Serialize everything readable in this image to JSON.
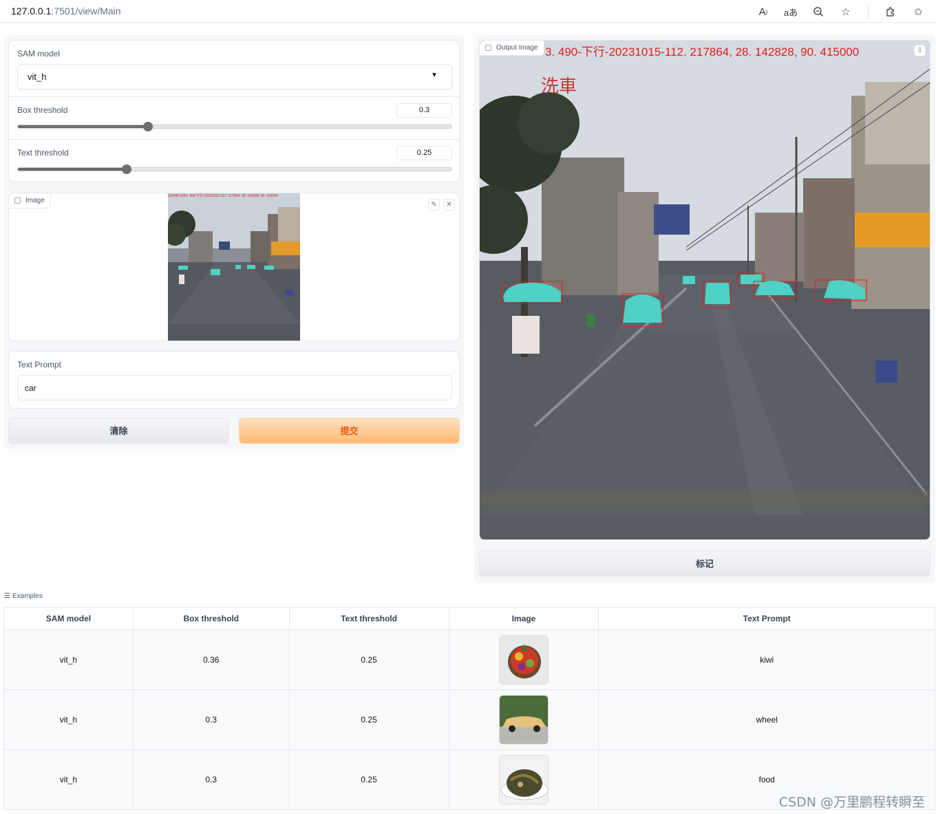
{
  "browser": {
    "url_host": "127.0.0.1",
    "url_path": ":7501/view/Main",
    "icons": [
      "read-aloud-icon",
      "translate-icon",
      "zoom-icon",
      "favorite-star-icon",
      "extensions-icon",
      "favorites-icon"
    ]
  },
  "controls": {
    "sam_model": {
      "label": "SAM model",
      "value": "vit_h"
    },
    "box_threshold": {
      "label": "Box threshold",
      "value": "0.3",
      "fraction": 0.3
    },
    "text_threshold": {
      "label": "Text threshold",
      "value": "0.25",
      "fraction": 0.25
    },
    "image": {
      "label": "Image",
      "caption": "Q234B-2193. 490-下行-20231015-112. 217864, 28. 142828, 90. 415000"
    },
    "text_prompt": {
      "label": "Text Prompt",
      "value": "car"
    }
  },
  "buttons": {
    "clear": "清除",
    "submit": "提交",
    "mark": "标记"
  },
  "output": {
    "label": "Output Image",
    "caption": "3. 490-下行-20231015-112. 217864, 28. 142828, 90. 415000",
    "roadside_sign": "洗車"
  },
  "examples": {
    "title": "Examples",
    "columns": [
      "SAM model",
      "Box threshold",
      "Text threshold",
      "Image",
      "Text Prompt"
    ],
    "rows": [
      {
        "model": "vit_h",
        "box": "0.36",
        "text": "0.25",
        "image": "fruit-plate",
        "prompt": "kiwi"
      },
      {
        "model": "vit_h",
        "box": "0.3",
        "text": "0.25",
        "image": "vintage-car",
        "prompt": "wheel"
      },
      {
        "model": "vit_h",
        "box": "0.3",
        "text": "0.25",
        "image": "food-plate",
        "prompt": "food"
      }
    ]
  },
  "watermark": "CSDN @万里鹏程转瞬至",
  "colors": {
    "accent": "#ea580c",
    "mask": "#4fd1c5",
    "box": "#e11d1d"
  }
}
